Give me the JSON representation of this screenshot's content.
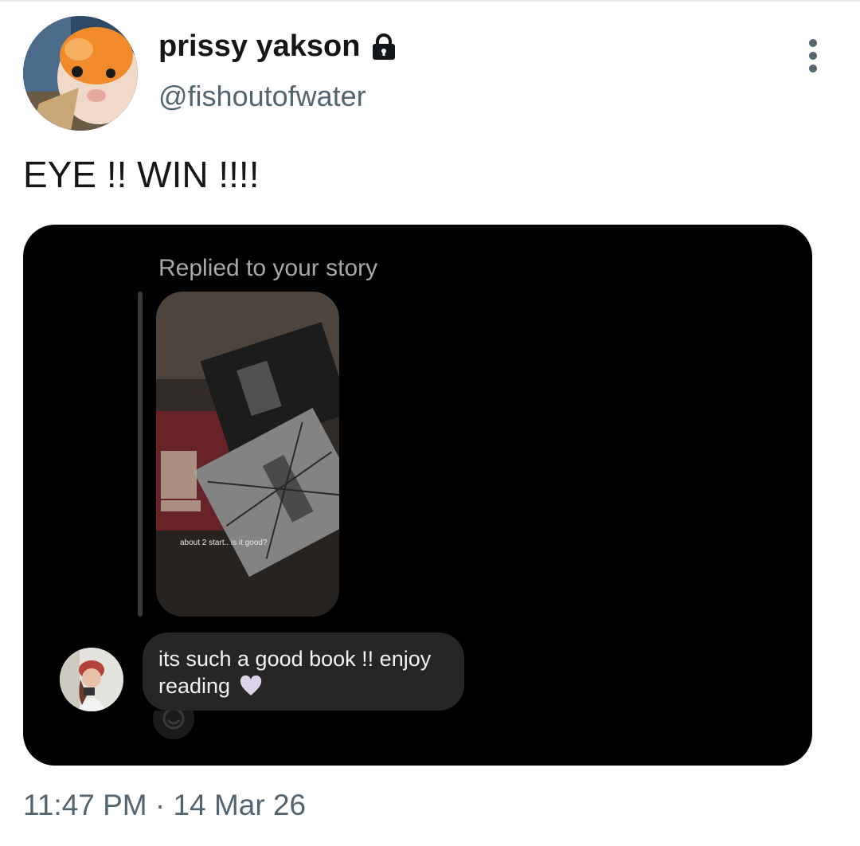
{
  "header": {
    "display_name": "prissy yakson",
    "handle": "@fishoutofwater",
    "lock_icon": "lock-icon",
    "more_icon": "more-vertical-icon"
  },
  "tweet": {
    "text": "EYE !! WIN !!!!",
    "timestamp": "11:47 PM · 14 Mar 26"
  },
  "media": {
    "replied_label": "Replied to your story",
    "story_caption": "about 2 start.. is it good?",
    "message_text": "its such a good book !! enjoy reading",
    "heart_icon": "purple-heart-icon",
    "react_icon": "emoji-reaction-icon",
    "card_color": "#000000",
    "bubble_color": "#262626"
  },
  "colors": {
    "text_primary": "#14171a",
    "text_secondary": "#536471"
  }
}
